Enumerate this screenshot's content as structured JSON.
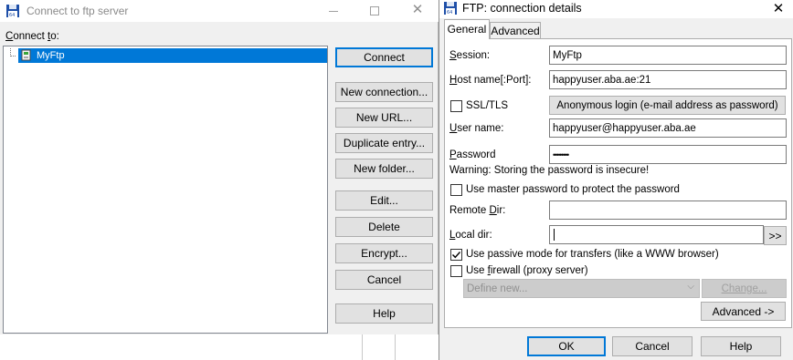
{
  "main_window": {
    "title": "Connect to ftp server",
    "connect_to_label": "Connect to:",
    "tree_items": [
      {
        "label": "MyFtp",
        "selected": true
      }
    ],
    "buttons": {
      "connect": "Connect",
      "new_connection": "New connection...",
      "new_url": "New URL...",
      "duplicate_entry": "Duplicate entry...",
      "new_folder": "New folder...",
      "edit": "Edit...",
      "delete": "Delete",
      "encrypt": "Encrypt...",
      "cancel": "Cancel",
      "help": "Help"
    }
  },
  "details_dialog": {
    "title": "FTP: connection details",
    "close_glyph": "✕",
    "tabs": [
      {
        "label": "General",
        "active": true
      },
      {
        "label": "Advanced",
        "active": false
      }
    ],
    "fields": {
      "session_label": "Session:",
      "session_value": "MyFtp",
      "host_label": "Host name[:Port]:",
      "host_value": "happyuser.aba.ae:21",
      "ssl_label": "SSL/TLS",
      "ssl_checked": false,
      "anonymous_button": "Anonymous login (e-mail address as password)",
      "user_label": "User name:",
      "user_value": "happyuser@happyuser.aba.ae",
      "password_label": "Password",
      "password_value": "••••••••",
      "warning_text": "Warning: Storing the password is insecure!",
      "master_password_label": "Use master password to protect the password",
      "master_password_checked": false,
      "remote_dir_label": "Remote Dir:",
      "remote_dir_value": "",
      "local_dir_label": "Local dir:",
      "local_dir_value": "",
      "browse_button": ">>",
      "passive_label": "Use passive mode for transfers (like a WWW browser)",
      "passive_checked": true,
      "firewall_label": "Use firewall (proxy server)",
      "firewall_checked": false,
      "firewall_select_value": "Define new...",
      "change_button": "Change...",
      "advanced_button": "Advanced ->"
    },
    "buttons": {
      "ok": "OK",
      "cancel": "Cancel",
      "help": "Help"
    }
  },
  "colors": {
    "selection": "#0078d7",
    "dialog_bg": "#f0f0f0",
    "button_bg": "#e1e1e1",
    "disabled_bg": "#cccccc"
  }
}
